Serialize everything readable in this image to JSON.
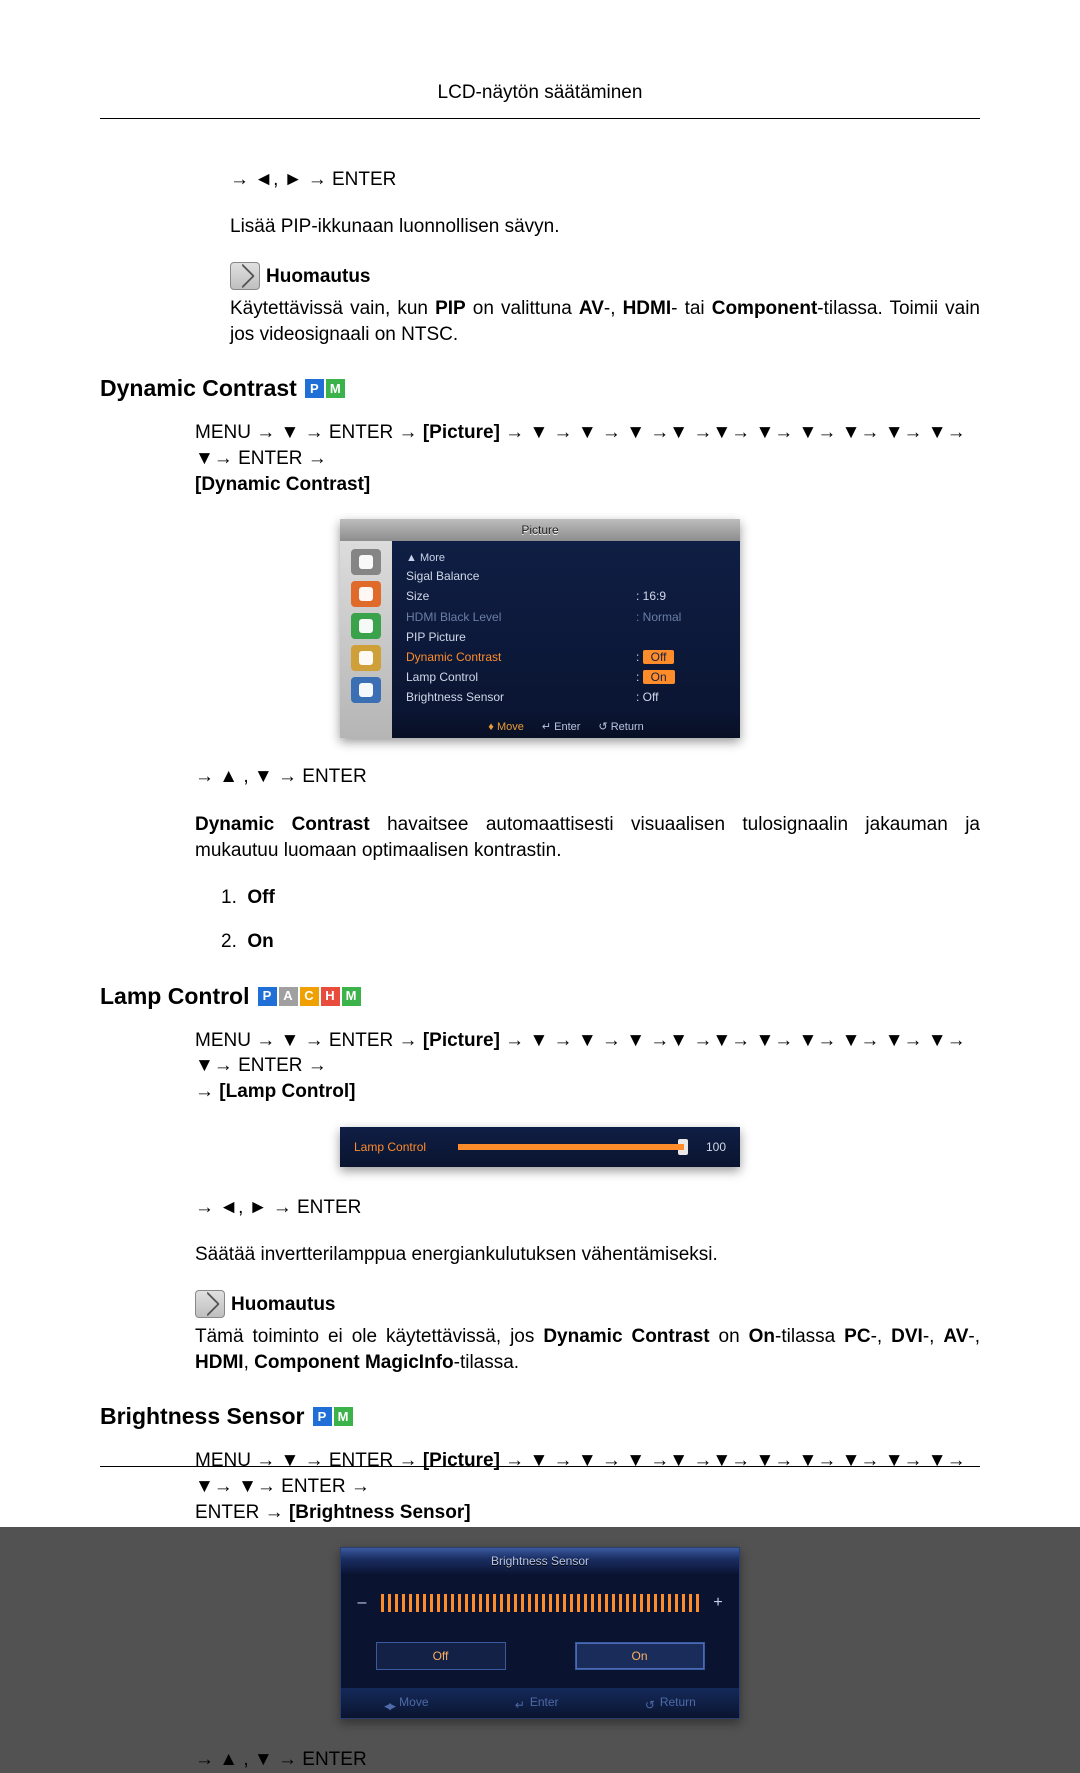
{
  "header": "LCD-näytön säätäminen",
  "intro": {
    "enterLine": "→ ◄, ► → ENTER",
    "line1": "Lisää PIP-ikkunaan luonnollisen sävyn.",
    "noteLabel": "Huomautus",
    "noteBody_a": "Käytettävissä vain, kun ",
    "noteBody_b": " on valittuna ",
    "noteBody_c": "- tai ",
    "noteBody_d": "-tilassa. Toimii vain jos videosignaali on NTSC.",
    "pip": "PIP",
    "av": "AV",
    "hdmi": "HDMI",
    "component": "Component"
  },
  "dynContrast": {
    "title": "Dynamic Contrast",
    "pathPre": "MENU → ▼ → ENTER → ",
    "pathPicture": "[Picture]",
    "pathMid": " → ▼ → ▼ → ▼ →▼ →▼→ ▼→ ▼→ ▼→ ▼→ ▼→ ▼→ ENTER → ",
    "pathBracket": "[Dynamic Contrast]",
    "osd": {
      "title": "Picture",
      "more": "▲ More",
      "rows": [
        {
          "l": "Sigal Balance",
          "v": ""
        },
        {
          "l": "Size",
          "v": ": 16:9"
        },
        {
          "l": "HDMI Black Level",
          "v": ": Normal",
          "dim": true
        },
        {
          "l": "PIP Picture",
          "v": ""
        },
        {
          "l": "Dynamic Contrast",
          "v": "Off",
          "hi": true,
          "pill": true
        },
        {
          "l": "Lamp Control",
          "v": "On",
          "pill": true
        },
        {
          "l": "Brightness Sensor",
          "v": ": Off"
        }
      ],
      "footMove": "Move",
      "footEnter": "Enter",
      "footReturn": "Return"
    },
    "enterLine": "→ ▲ , ▼ → ENTER",
    "desc_a": " havaitsee automaattisesti visuaalisen tulosignaalin jakauman ja mukautuu luomaan optimaalisen kontrastin.",
    "listOff": "Off",
    "listOn": "On"
  },
  "lamp": {
    "title": "Lamp Control",
    "pathPre": "MENU → ▼ → ENTER → ",
    "pathPicture": "[Picture]",
    "pathMid": " → ▼ → ▼ → ▼ →▼ →▼→ ▼→ ▼→ ▼→ ▼→ ▼→ ▼→ ENTER → ",
    "pathBracket": "[Lamp Control]",
    "osd": {
      "label": "Lamp Control",
      "value": "100"
    },
    "enterLine": "→ ◄, ► → ENTER",
    "desc": "Säätää invertterilamppua energiankulutuksen vähentämiseksi.",
    "noteLabel": "Huomautus",
    "note_a": "Tämä toiminto ei ole käytettävissä, jos ",
    "note_b": " on ",
    "note_c": "-tilassa ",
    "note_d": "-tilassa.",
    "dc": "Dynamic Contrast",
    "on": "On",
    "pc": "PC",
    "dvi": "DVI",
    "av": "AV",
    "hdmi": "HDMI",
    "comp": "Component",
    "mi": "MagicInfo"
  },
  "bright": {
    "title": "Brightness Sensor",
    "pathPre": "MENU → ▼ → ENTER → ",
    "pathPicture": "[Picture]",
    "pathMid": " → ▼ → ▼ → ▼ →▼ →▼→ ▼→ ▼→ ▼→ ▼→ ▼→ ▼→ ▼→ ENTER → ",
    "pathBracket": "[Brightness Sensor]",
    "osd": {
      "title": "Brightness Sensor",
      "off": "Off",
      "on": "On",
      "move": "Move",
      "enter": "Enter",
      "return": "Return"
    },
    "enterLine": "→ ▲ , ▼ → ENTER"
  }
}
